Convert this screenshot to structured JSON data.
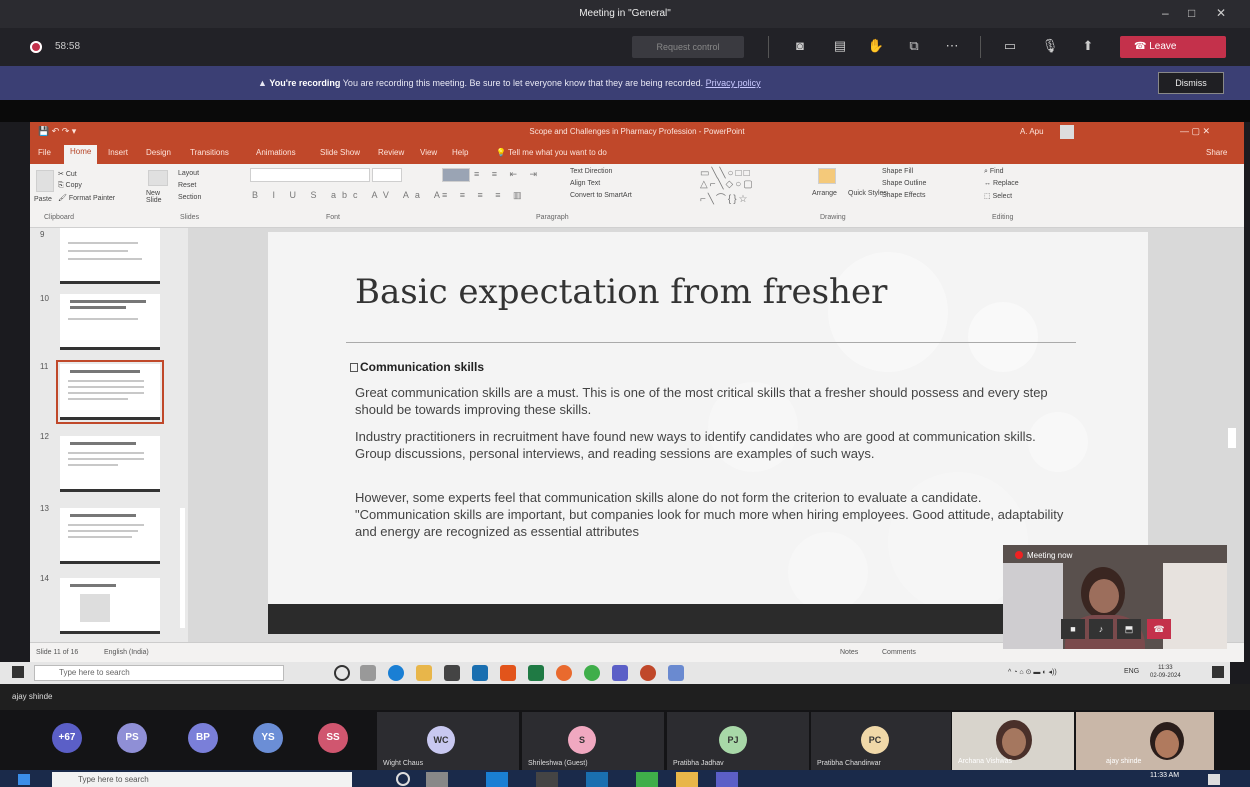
{
  "teams": {
    "window_title": "Meeting in \"General\"",
    "timer": "58:58",
    "request_control": "Request control",
    "leave_label": "Leave",
    "window_controls": [
      "–",
      "□",
      "✕"
    ],
    "toolbar_icons": [
      "camera-icon",
      "chat-icon",
      "raise-hand-icon",
      "breakout-icon",
      "more-icon",
      "camera-toggle-icon",
      "mic-icon",
      "share-icon"
    ]
  },
  "banner": {
    "strong": "You're recording",
    "message": " You are recording this meeting. Be sure to let everyone know that they are being recorded. ",
    "link": "Privacy policy",
    "dismiss": "Dismiss"
  },
  "ppt": {
    "title": "Scope and Challenges in Pharmacy Profession - PowerPoint",
    "user": "A. Apu",
    "tabs": [
      "File",
      "Home",
      "Insert",
      "Design",
      "Transitions",
      "Animations",
      "Slide Show",
      "Review",
      "View",
      "Help",
      "Tell me what you want to do"
    ],
    "share": "Share",
    "ribbon": {
      "groups": [
        "Clipboard",
        "Slides",
        "Font",
        "Paragraph",
        "Drawing",
        "Editing"
      ],
      "cut": "Cut",
      "copy": "Copy",
      "format_painter": "Format Painter",
      "paste": "Paste",
      "new_slide": "New Slide",
      "layout": "Layout",
      "reset": "Reset",
      "section": "Section",
      "text_direction": "Text Direction",
      "align_text": "Align Text",
      "convert_smartart": "Convert to SmartArt",
      "arrange": "Arrange",
      "quick_styles": "Quick Styles",
      "shape_fill": "Shape Fill",
      "shape_outline": "Shape Outline",
      "shape_effects": "Shape Effects",
      "find": "Find",
      "replace": "Replace",
      "select": "Select"
    },
    "thumbnails": [
      {
        "num": "9"
      },
      {
        "num": "10"
      },
      {
        "num": "11"
      },
      {
        "num": "12"
      },
      {
        "num": "13"
      },
      {
        "num": "14"
      }
    ],
    "status": {
      "slide": "Slide 11 of 16",
      "language": "English (India)",
      "notes": "Notes",
      "comments": "Comments"
    }
  },
  "slide": {
    "title": "Basic expectation from fresher",
    "heading": "Communication skills",
    "paragraphs": [
      "Great communication skills are a must. This is one of the most critical skills that a fresher should possess and every step should be towards improving these skills.",
      "Industry practitioners in recruitment have found new ways to identify candidates who are good at communication skills. Group discussions, personal interviews, and reading sessions are examples of such ways.",
      "However, some experts feel that communication skills alone do not form the criterion to evaluate a candidate. \"Communication skills are important, but companies look for much more when hiring employees. Good attitude, adaptability and energy are recognized as essential attributes"
    ]
  },
  "video": {
    "recording": "Meeting now"
  },
  "inner_taskbar": {
    "search_placeholder": "Type here to search",
    "time": "11:33",
    "date": "02-09-2024",
    "lang": "ENG"
  },
  "caption": "ajay shinde",
  "roster": {
    "avatars": [
      {
        "label": "+67",
        "color": "#5b5fc7"
      },
      {
        "label": "PS",
        "color": "#8f8fd6"
      },
      {
        "label": "BP",
        "color": "#7a7fd9"
      },
      {
        "label": "YS",
        "color": "#6b8ed6"
      },
      {
        "label": "SS",
        "color": "#d0566f"
      }
    ],
    "tiles": [
      {
        "initials": "WC",
        "name": "Wight Chaus",
        "color": "#c8c8f0"
      },
      {
        "initials": "S",
        "name": "Shrileshwa (Guest)",
        "color": "#f0a8c0"
      },
      {
        "initials": "PJ",
        "name": "Pratibha Jadhav",
        "color": "#a8d8a8"
      },
      {
        "initials": "PC",
        "name": "Pratibha Chandirwar",
        "color": "#f0d8a8"
      }
    ],
    "cam_names": [
      "Archana Vishwas",
      "ajay shinde"
    ]
  },
  "outer_taskbar": {
    "search_placeholder": "Type here to search",
    "time": "11:33 AM"
  }
}
